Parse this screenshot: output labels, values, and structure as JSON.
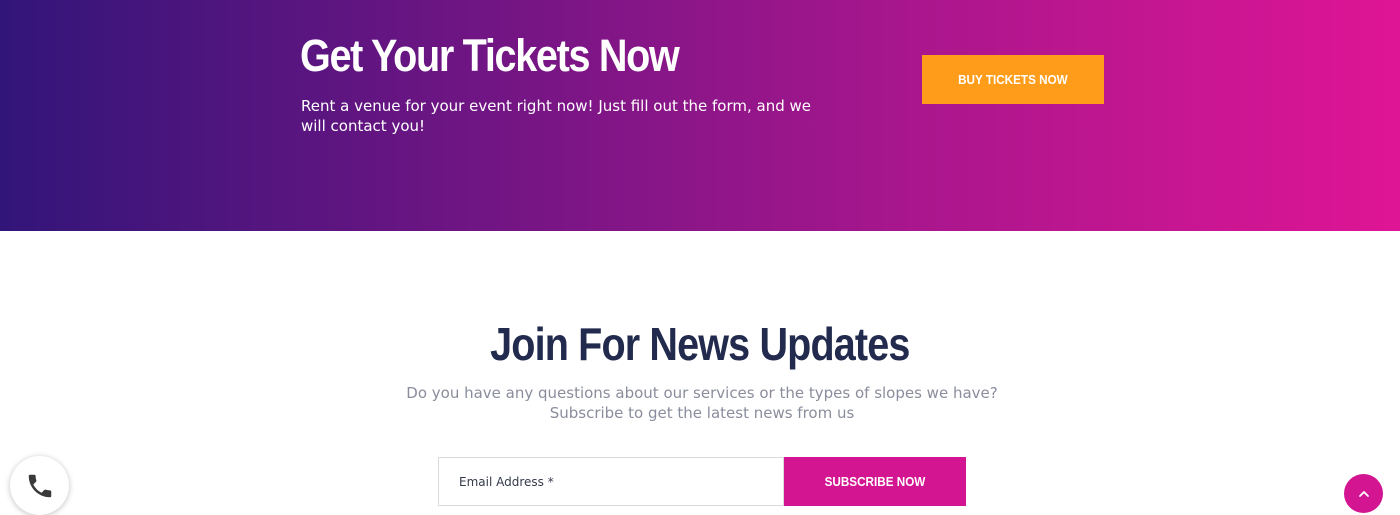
{
  "hero": {
    "title": "Get Your Tickets Now",
    "text": "Rent a venue for your event right now! Just fill out the form, and we will contact you!",
    "button_label": "Buy Tickets Now",
    "gradient_start": "#321579",
    "gradient_end": "#df1595",
    "button_color": "#ff9c1a"
  },
  "newsletter": {
    "title": "Join For News Updates",
    "subtitle": "Do you have any questions about our services or the types of slopes we have? Subscribe to get the latest news from us",
    "email_placeholder": "Email Address *",
    "subscribe_label": "Subscribe Now",
    "accent_color": "#d41592",
    "title_color": "#222b4d"
  },
  "floating": {
    "call_icon": "phone-icon",
    "top_icon": "chevron-up-icon"
  }
}
